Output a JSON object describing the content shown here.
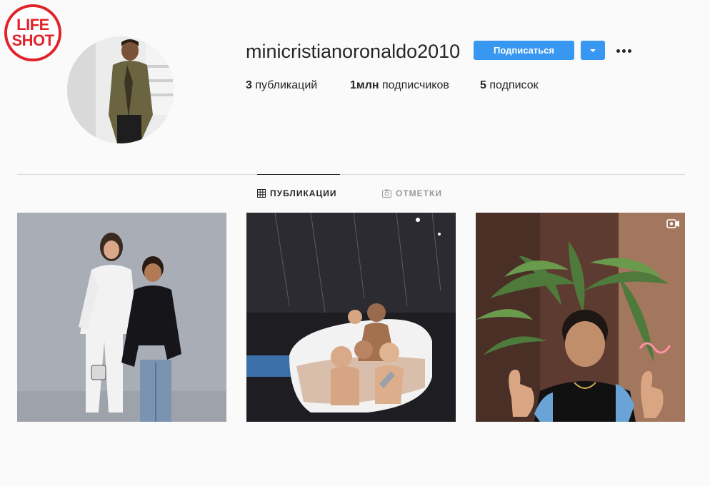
{
  "watermark": {
    "line1": "LIFE",
    "line2": "SHOT"
  },
  "profile": {
    "username": "minicristianoronaldo2010",
    "follow_label": "Подписаться",
    "stats": {
      "posts_count": "3",
      "posts_label": "публикаций",
      "followers_count": "1млн",
      "followers_label": "подписчиков",
      "following_count": "5",
      "following_label": "подписок"
    }
  },
  "tabs": [
    {
      "label": "ПУБЛИКАЦИИ",
      "icon": "grid-icon",
      "active": true
    },
    {
      "label": "ОТМЕТКИ",
      "icon": "tagged-icon",
      "active": false
    }
  ],
  "posts": [
    {
      "subject": "woman in white suit with boy in black jacket",
      "video": false
    },
    {
      "subject": "man with children in a bathtub",
      "video": false
    },
    {
      "subject": "boy giving thumbs up in front of plants",
      "video": true
    }
  ],
  "colors": {
    "accent": "#3897f0",
    "watermark": "#e0232b",
    "text": "#262626",
    "muted": "#999999"
  }
}
